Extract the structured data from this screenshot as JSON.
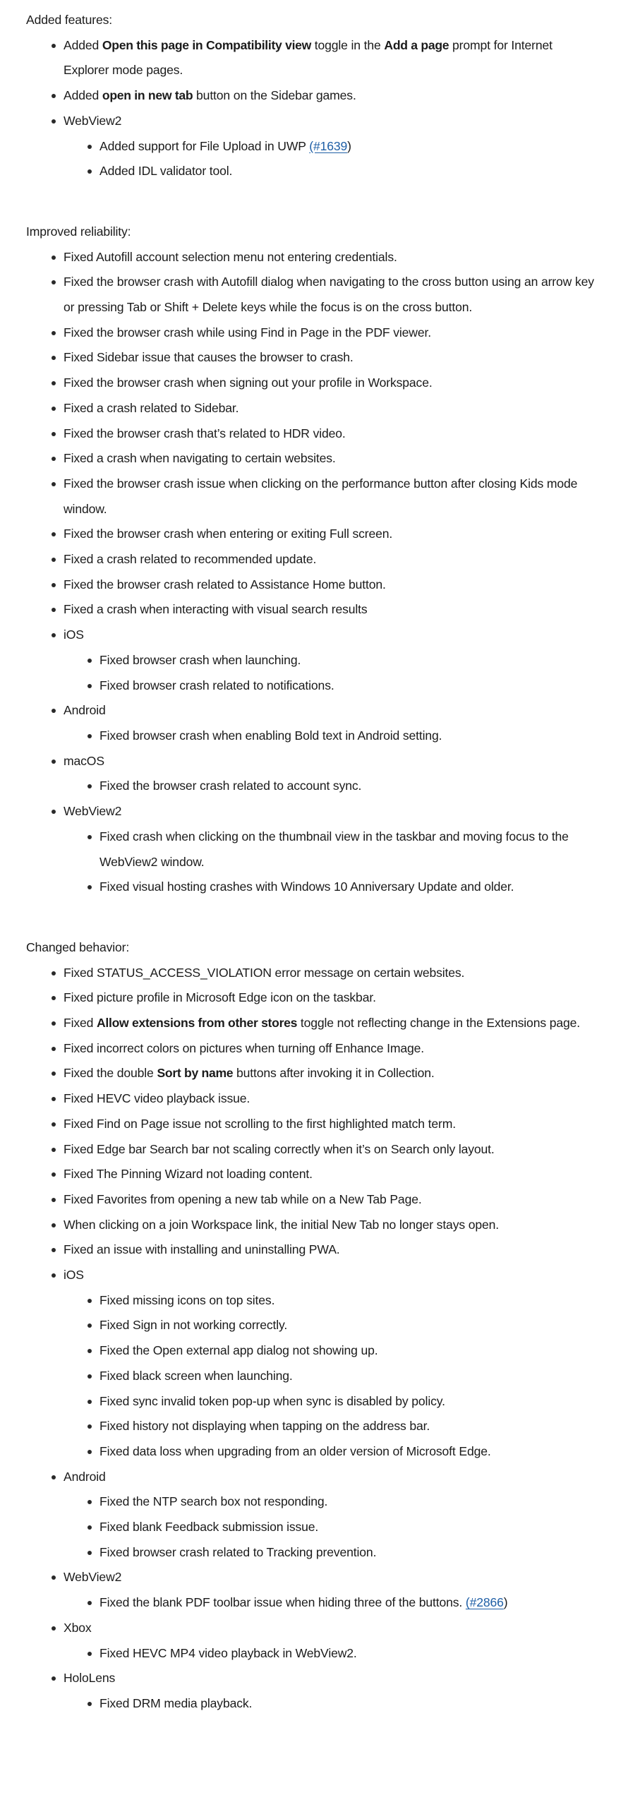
{
  "sections": [
    {
      "heading": "Added features:",
      "items": [
        {
          "runs": [
            {
              "t": "Added "
            },
            {
              "t": "Open this page in Compatibility view",
              "b": true
            },
            {
              "t": " toggle in the "
            },
            {
              "t": "Add a page",
              "b": true
            },
            {
              "t": " prompt for Internet Explorer mode pages."
            }
          ]
        },
        {
          "runs": [
            {
              "t": "Added "
            },
            {
              "t": "open in new tab",
              "b": true
            },
            {
              "t": " button on the Sidebar games."
            }
          ]
        },
        {
          "runs": [
            {
              "t": "WebView2"
            }
          ],
          "sub": [
            {
              "runs": [
                {
                  "t": "Added support for File Upload in UWP "
                },
                {
                  "t": "(#1639",
                  "link": true
                },
                {
                  "t": ")"
                }
              ]
            },
            {
              "runs": [
                {
                  "t": "Added IDL validator tool."
                }
              ]
            }
          ]
        }
      ]
    },
    {
      "heading": "Improved reliability:",
      "items": [
        {
          "runs": [
            {
              "t": "Fixed Autofill account selection menu not entering credentials."
            }
          ]
        },
        {
          "runs": [
            {
              "t": "Fixed the browser crash with Autofill dialog when navigating to the cross button using an arrow key or pressing Tab or Shift + Delete keys while the focus is on the cross button."
            }
          ]
        },
        {
          "runs": [
            {
              "t": "Fixed the browser crash while using Find in Page in the PDF viewer."
            }
          ]
        },
        {
          "runs": [
            {
              "t": "Fixed Sidebar issue that causes the browser to crash."
            }
          ]
        },
        {
          "runs": [
            {
              "t": "Fixed the browser crash when signing out your profile in Workspace."
            }
          ]
        },
        {
          "runs": [
            {
              "t": "Fixed a crash related to Sidebar."
            }
          ]
        },
        {
          "runs": [
            {
              "t": "Fixed the browser crash that’s related to HDR video."
            }
          ]
        },
        {
          "runs": [
            {
              "t": "Fixed a crash when navigating to certain websites."
            }
          ]
        },
        {
          "runs": [
            {
              "t": "Fixed the browser crash issue when clicking on the performance button after closing Kids mode window."
            }
          ]
        },
        {
          "runs": [
            {
              "t": "Fixed the browser crash when entering or exiting Full screen."
            }
          ]
        },
        {
          "runs": [
            {
              "t": "Fixed a crash related to recommended update."
            }
          ]
        },
        {
          "runs": [
            {
              "t": "Fixed the browser crash related to Assistance Home button."
            }
          ]
        },
        {
          "runs": [
            {
              "t": "Fixed a crash when interacting with visual search results"
            }
          ]
        },
        {
          "runs": [
            {
              "t": "iOS"
            }
          ],
          "sub": [
            {
              "runs": [
                {
                  "t": "Fixed browser crash when launching."
                }
              ]
            },
            {
              "runs": [
                {
                  "t": "Fixed browser crash related to notifications."
                }
              ]
            }
          ]
        },
        {
          "runs": [
            {
              "t": "Android"
            }
          ],
          "sub": [
            {
              "runs": [
                {
                  "t": "Fixed browser crash when enabling Bold text in Android setting."
                }
              ]
            }
          ]
        },
        {
          "runs": [
            {
              "t": "macOS"
            }
          ],
          "sub": [
            {
              "runs": [
                {
                  "t": "Fixed the browser crash related to account sync."
                }
              ]
            }
          ]
        },
        {
          "runs": [
            {
              "t": "WebView2"
            }
          ],
          "sub": [
            {
              "runs": [
                {
                  "t": "Fixed crash when clicking on the thumbnail view in the taskbar and moving focus to the WebView2 window."
                }
              ]
            },
            {
              "runs": [
                {
                  "t": "Fixed visual hosting crashes with Windows 10 Anniversary Update and older."
                }
              ]
            }
          ]
        }
      ]
    },
    {
      "heading": "Changed behavior:",
      "items": [
        {
          "runs": [
            {
              "t": "Fixed STATUS_ACCESS_VIOLATION error message on certain websites."
            }
          ]
        },
        {
          "runs": [
            {
              "t": "Fixed picture profile in Microsoft Edge icon on the taskbar."
            }
          ]
        },
        {
          "runs": [
            {
              "t": "Fixed "
            },
            {
              "t": "Allow extensions from other stores",
              "b": true
            },
            {
              "t": " toggle not reflecting change in the Extensions page."
            }
          ]
        },
        {
          "runs": [
            {
              "t": "Fixed incorrect colors on pictures when turning off Enhance Image."
            }
          ]
        },
        {
          "runs": [
            {
              "t": "Fixed the double "
            },
            {
              "t": "Sort by name",
              "b": true
            },
            {
              "t": " buttons after invoking it in Collection."
            }
          ]
        },
        {
          "runs": [
            {
              "t": "Fixed HEVC video playback issue."
            }
          ]
        },
        {
          "runs": [
            {
              "t": "Fixed Find on Page issue not scrolling to the first highlighted match term."
            }
          ]
        },
        {
          "runs": [
            {
              "t": "Fixed Edge bar Search bar not scaling correctly when it’s on Search only layout."
            }
          ]
        },
        {
          "runs": [
            {
              "t": "Fixed The Pinning Wizard not loading content."
            }
          ]
        },
        {
          "runs": [
            {
              "t": "Fixed Favorites from opening a new tab while on a New Tab Page."
            }
          ]
        },
        {
          "runs": [
            {
              "t": "When clicking on a join Workspace link, the initial New Tab no longer stays open."
            }
          ]
        },
        {
          "runs": [
            {
              "t": "Fixed an issue with installing and uninstalling PWA."
            }
          ]
        },
        {
          "runs": [
            {
              "t": "iOS"
            }
          ],
          "sub": [
            {
              "runs": [
                {
                  "t": "Fixed missing icons on top sites."
                }
              ]
            },
            {
              "runs": [
                {
                  "t": "Fixed Sign in not working correctly."
                }
              ]
            },
            {
              "runs": [
                {
                  "t": "Fixed the Open external app dialog not showing up."
                }
              ]
            },
            {
              "runs": [
                {
                  "t": "Fixed black screen when launching."
                }
              ]
            },
            {
              "runs": [
                {
                  "t": "Fixed sync invalid token pop-up when sync is disabled by policy."
                }
              ]
            },
            {
              "runs": [
                {
                  "t": "Fixed history not displaying when tapping on the address bar."
                }
              ]
            },
            {
              "runs": [
                {
                  "t": "Fixed data loss when upgrading from an older version of Microsoft Edge."
                }
              ]
            }
          ]
        },
        {
          "runs": [
            {
              "t": "Android"
            }
          ],
          "sub": [
            {
              "runs": [
                {
                  "t": "Fixed the NTP search box not responding."
                }
              ]
            },
            {
              "runs": [
                {
                  "t": "Fixed blank Feedback submission issue."
                }
              ]
            },
            {
              "runs": [
                {
                  "t": "Fixed browser crash related to Tracking prevention."
                }
              ]
            }
          ]
        },
        {
          "runs": [
            {
              "t": "WebView2"
            }
          ],
          "sub": [
            {
              "runs": [
                {
                  "t": "Fixed the blank PDF toolbar issue when hiding three of the buttons. "
                },
                {
                  "t": "(#2866",
                  "link": true
                },
                {
                  "t": ")"
                }
              ]
            }
          ]
        },
        {
          "runs": [
            {
              "t": "Xbox"
            }
          ],
          "sub": [
            {
              "runs": [
                {
                  "t": "Fixed HEVC MP4 video playback in WebView2."
                }
              ]
            }
          ]
        },
        {
          "runs": [
            {
              "t": "HoloLens"
            }
          ],
          "sub": [
            {
              "runs": [
                {
                  "t": "Fixed DRM media playback."
                }
              ]
            }
          ]
        }
      ]
    }
  ]
}
